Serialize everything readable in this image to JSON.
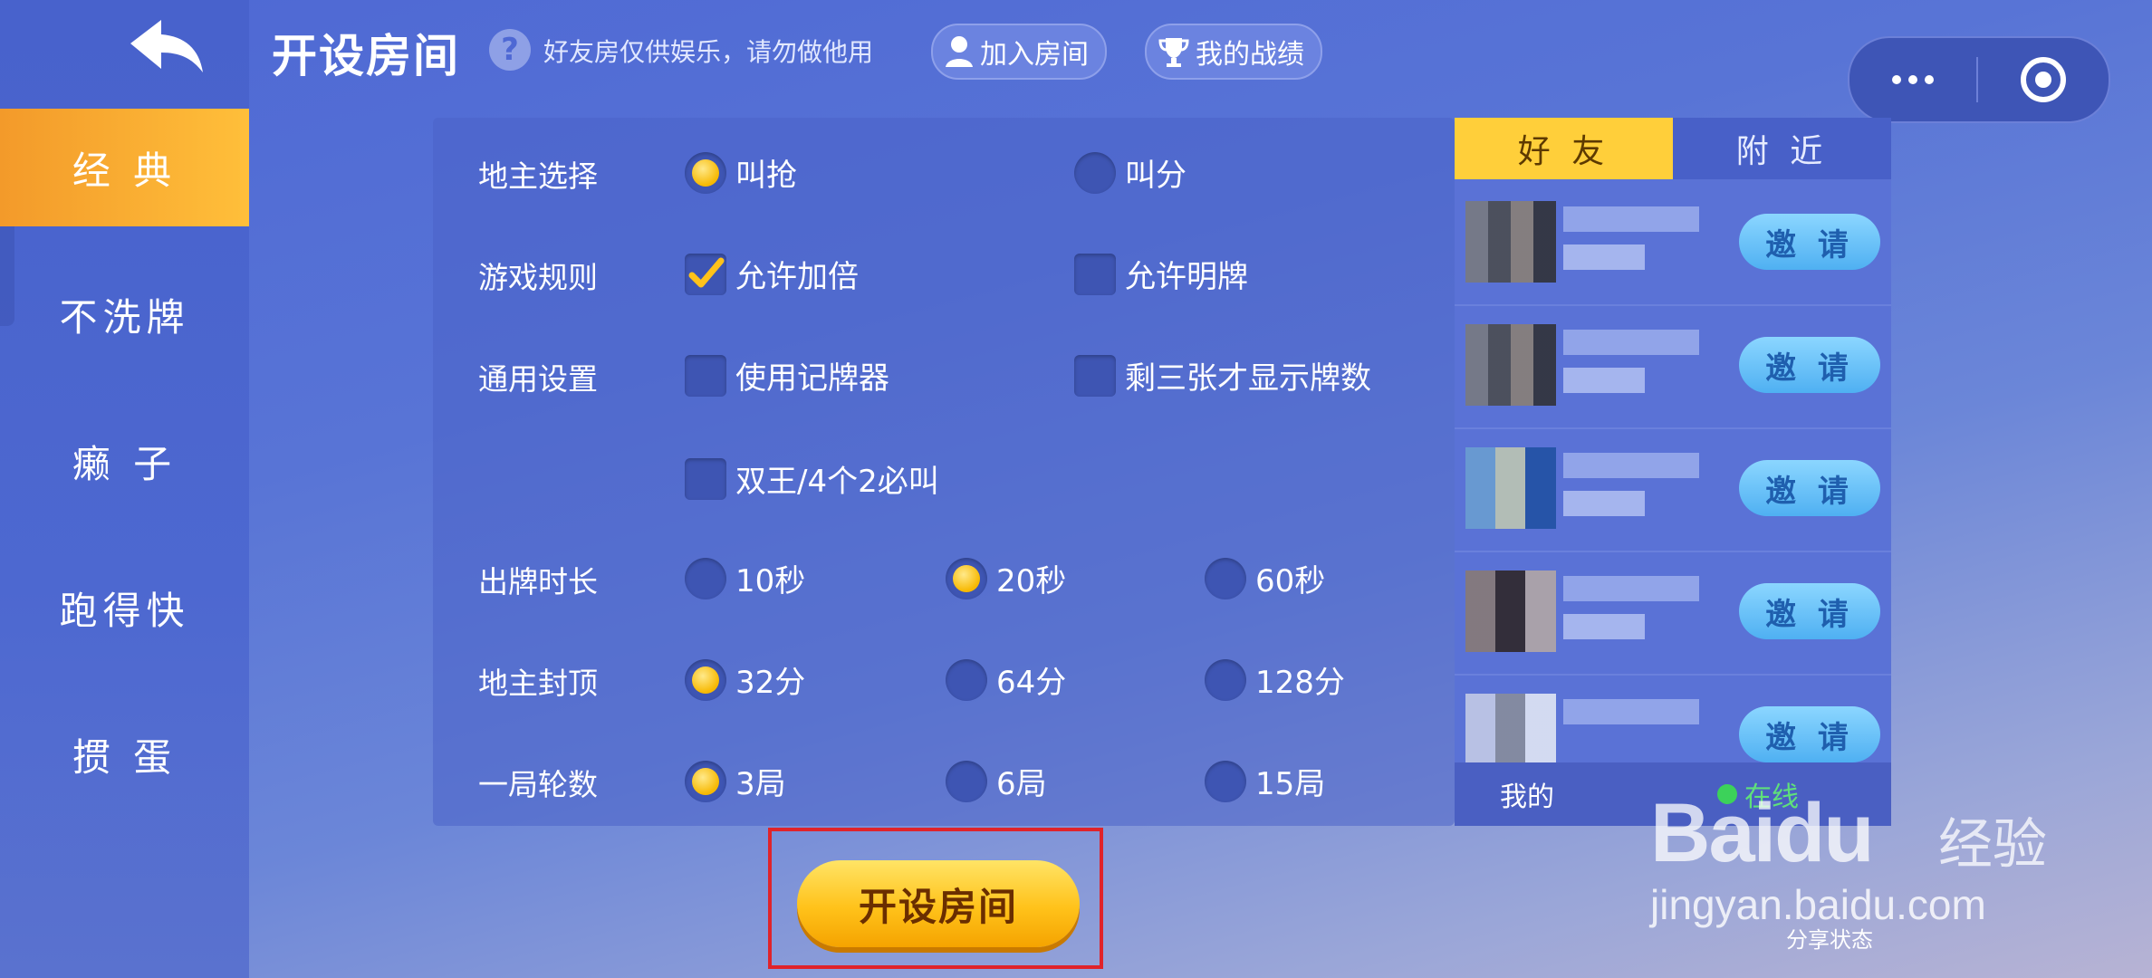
{
  "header": {
    "title": "开设房间",
    "help_icon": "?",
    "note": "好友房仅供娱乐，请勿做他用",
    "join_room": "加入房间",
    "my_record": "我的战绩"
  },
  "sidebar": {
    "items": [
      {
        "label": "经 典",
        "active": true
      },
      {
        "label": "不洗牌",
        "active": false
      },
      {
        "label": "癞 子",
        "active": false
      },
      {
        "label": "跑得快",
        "active": false
      },
      {
        "label": "掼 蛋",
        "active": false
      }
    ]
  },
  "options": {
    "landlord_select": {
      "label": "地主选择",
      "a": "叫抢",
      "b": "叫分",
      "selected": "叫抢"
    },
    "game_rules": {
      "label": "游戏规则",
      "a": "允许加倍",
      "b": "允许明牌",
      "checked_a": true,
      "checked_b": false
    },
    "general": {
      "label": "通用设置",
      "a": "使用记牌器",
      "b": "剩三张才显示牌数",
      "c": "双王/4个2必叫"
    },
    "play_time": {
      "label": "出牌时长",
      "a": "10秒",
      "b": "20秒",
      "c": "60秒",
      "selected": "20秒"
    },
    "cap": {
      "label": "地主封顶",
      "a": "32分",
      "b": "64分",
      "c": "128分",
      "selected": "32分"
    },
    "rounds": {
      "label": "一局轮数",
      "a": "3局",
      "b": "6局",
      "c": "15局",
      "selected": "3局"
    }
  },
  "friends": {
    "tab_friends": "好 友",
    "tab_nearby": "附 近",
    "invite_label": "邀 请",
    "me_label": "我的",
    "online_label": "在线"
  },
  "create_button": "开设房间",
  "watermark": {
    "brand": "Baidu",
    "brand_cn": "经验",
    "url": "jingyan.baidu.com",
    "share": "分享状态"
  },
  "colors": {
    "accent_orange": "#f39a2a",
    "button_yellow": "#ffc21a",
    "invite_blue": "#4fb0f2",
    "highlight_red": "#e0232a"
  }
}
